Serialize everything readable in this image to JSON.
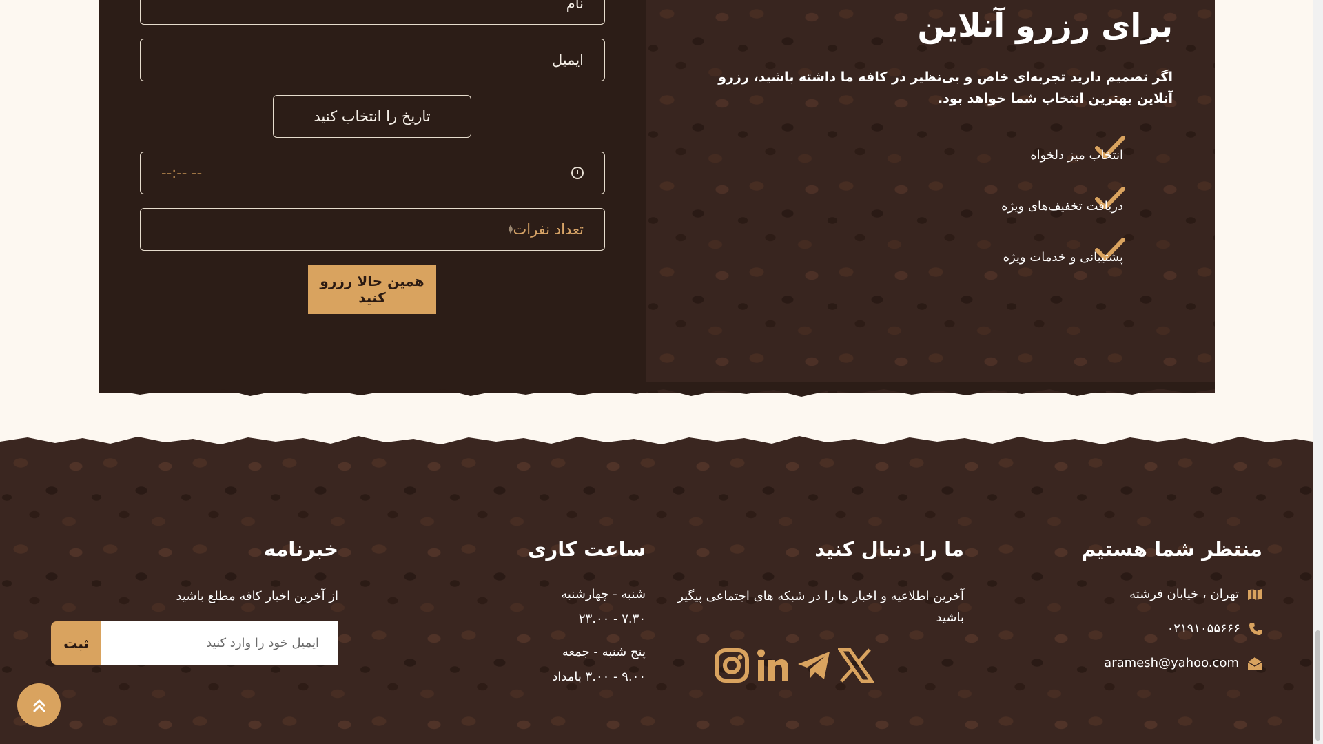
{
  "reservation": {
    "name_placeholder": "نام",
    "email_placeholder": "ایمیل",
    "date_label": "تاریخ را انتخاب کنید",
    "time_placeholder": "--:-- --",
    "people_placeholder": "تعداد نفرات",
    "submit_label": "همین حالا رزرو کنید",
    "title": "برای رزرو آنلاین",
    "description": "اگر تصمیم دارید تجربه‌ای خاص و بی‌نظیر در کافه ما داشته باشید، رزرو آنلاین بهترین انتخاب شما خواهد بود.",
    "features": [
      "انتخاب میز دلخواه",
      "دریافت تخفیف‌های ویژه",
      "پشتیبانی و خدمات ویژه"
    ]
  },
  "footer": {
    "contact": {
      "title": "منتظر شما هستیم",
      "address": "تهران ، خیابان فرشته",
      "phone": "۰۲۱۹۱۰۵۵۶۶۶",
      "email": "aramesh@yahoo.com"
    },
    "follow": {
      "title": "ما را دنبال کنید",
      "text": "آخرین اطلاعیه و اخبار ها را در شبکه های اجتماعی پیگیر باشید"
    },
    "hours": {
      "title": "ساعت کاری",
      "days1": "شنبه - چهارشنبه",
      "time1": "۷.۳۰ - ۲۳.۰۰",
      "days2": "پنج شنبه - جمعه",
      "time2": "۹.۰۰ - ۳.۰۰ بامداد"
    },
    "newsletter": {
      "title": "خبرنامه",
      "text": "از آخرین اخبار کافه مطلع باشید",
      "input_placeholder": "ایمیل خود را وارد کنید",
      "submit_label": "ثبت"
    }
  },
  "colors": {
    "accent": "#d9a35f",
    "dark_brown": "#2c1d17",
    "cream": "#fdf8f1"
  },
  "icons": {
    "check": "check-icon",
    "map": "map-icon",
    "phone": "phone-icon",
    "envelope": "envelope-open-icon",
    "instagram": "instagram-icon",
    "linkedin": "linkedin-icon",
    "telegram": "telegram-icon",
    "x": "x-twitter-icon",
    "scroll_top": "double-chevron-up-icon"
  }
}
